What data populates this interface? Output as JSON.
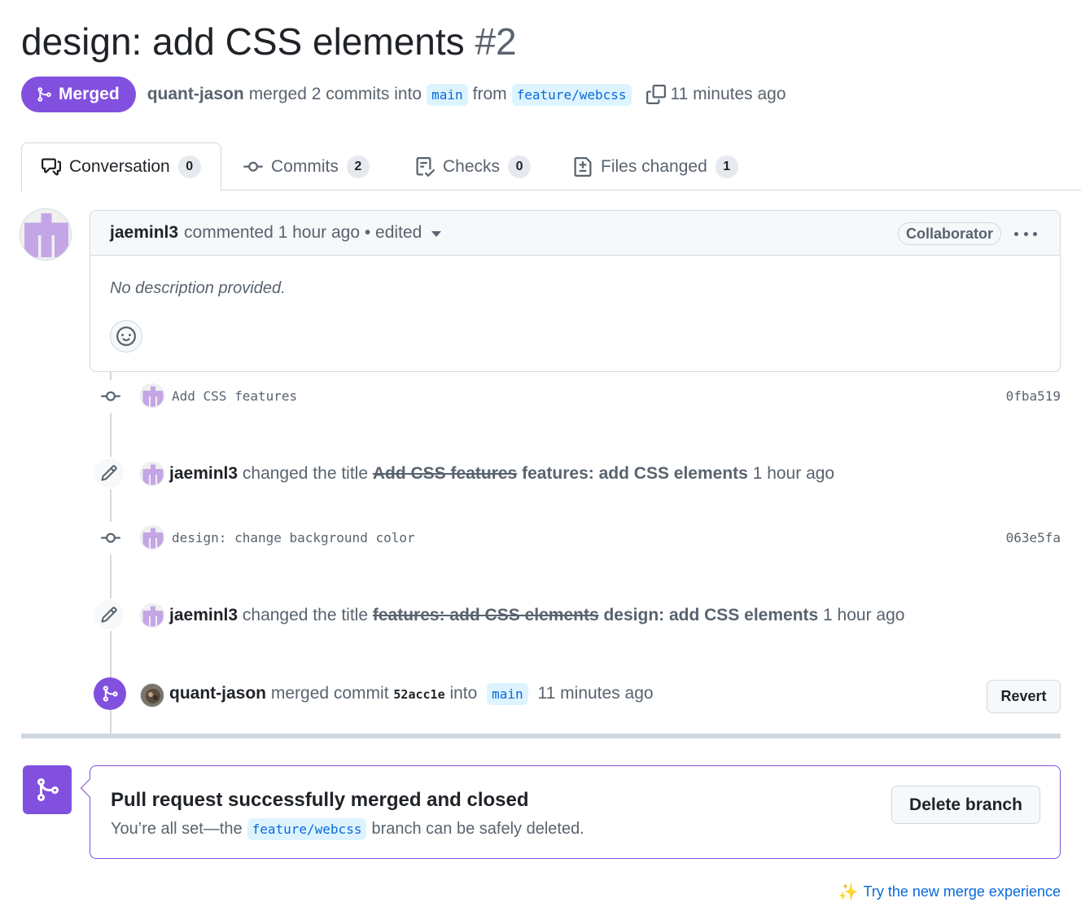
{
  "pr": {
    "title": "design: add CSS elements",
    "number": "#2",
    "state": "Merged",
    "author": "quant-jason",
    "merged_text": "merged 2 commits into",
    "base_branch": "main",
    "from_text": "from",
    "head_branch": "feature/webcss",
    "time": "11 minutes ago"
  },
  "tabs": [
    {
      "label": "Conversation",
      "count": "0",
      "icon": "comment-discussion-icon"
    },
    {
      "label": "Commits",
      "count": "2",
      "icon": "git-commit-icon"
    },
    {
      "label": "Checks",
      "count": "0",
      "icon": "checklist-icon"
    },
    {
      "label": "Files changed",
      "count": "1",
      "icon": "file-diff-icon"
    }
  ],
  "comment": {
    "author": "jaeminl3",
    "action": "commented",
    "time": "1 hour ago",
    "edited": "• edited",
    "role": "Collaborator",
    "body": "No description provided."
  },
  "timeline": {
    "commit1": {
      "message": "Add CSS features",
      "sha": "0fba519"
    },
    "rename1": {
      "author": "jaeminl3",
      "action": "changed the title",
      "old": "Add CSS features",
      "new": "features: add CSS elements",
      "time": "1 hour ago"
    },
    "commit2": {
      "message": "design: change background color",
      "sha": "063e5fa"
    },
    "rename2": {
      "author": "jaeminl3",
      "action": "changed the title",
      "old": "features: add CSS elements",
      "new": "design: add CSS elements",
      "time": "1 hour ago"
    },
    "merged": {
      "author": "quant-jason",
      "action": "merged commit",
      "sha": "52acc1e",
      "into": "into",
      "branch": "main",
      "time": "11 minutes ago",
      "revert_label": "Revert"
    }
  },
  "merge_box": {
    "title": "Pull request successfully merged and closed",
    "desc_before": "You’re all set—the",
    "branch": "feature/webcss",
    "desc_after": "branch can be safely deleted.",
    "delete_label": "Delete branch"
  },
  "footer": {
    "sparkle": "✨",
    "link": "Try the new merge experience"
  },
  "colors": {
    "accent_purple": "#8250df",
    "link_blue": "#0969da",
    "branch_bg": "#ddf4ff",
    "identicon": "#c4a6e6"
  }
}
